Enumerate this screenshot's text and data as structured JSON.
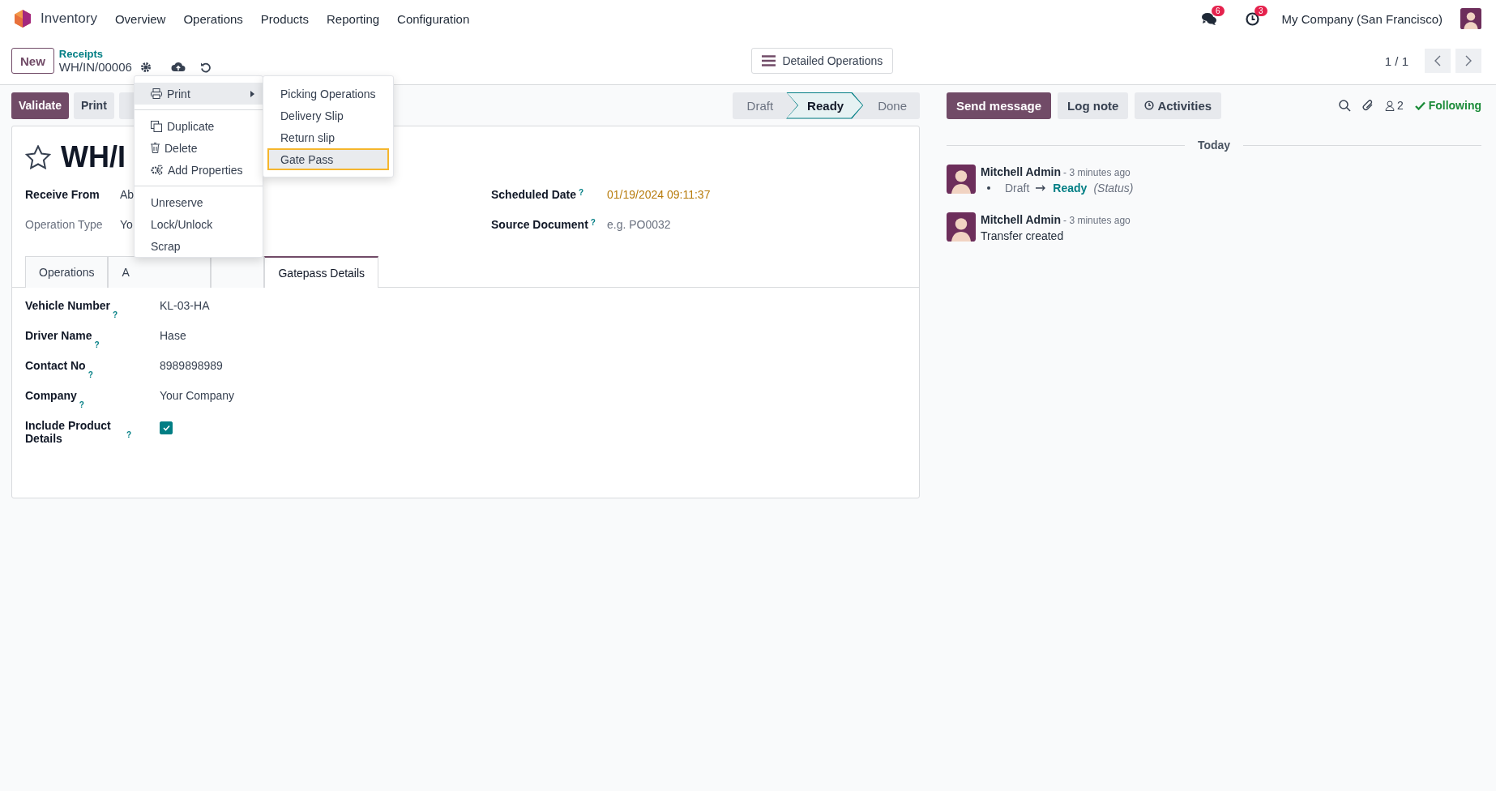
{
  "navbar": {
    "app_name": "Inventory",
    "menu": [
      "Overview",
      "Operations",
      "Products",
      "Reporting",
      "Configuration"
    ],
    "messages_badge": "6",
    "activities_badge": "3",
    "company": "My Company (San Francisco)"
  },
  "control_panel": {
    "new_button": "New",
    "breadcrumb": "Receipts",
    "record": "WH/IN/00006",
    "view_button": "Detailed Operations",
    "pager": "1 / 1"
  },
  "actions": {
    "buttons": [
      {
        "label": "Validate",
        "kind": "primary"
      },
      {
        "label": "Print",
        "kind": "secondary"
      },
      {
        "kind": "secondary"
      }
    ],
    "statusbar": [
      {
        "label": "Draft",
        "selected": false
      },
      {
        "label": "Ready",
        "selected": true
      },
      {
        "label": "Done",
        "selected": false
      }
    ]
  },
  "action_menu": {
    "groups": [
      [
        {
          "label": "Print",
          "kind": "submenu",
          "selected": true
        }
      ],
      [
        {
          "label": "Duplicate",
          "kind": "copy",
          "selected": false
        },
        {
          "label": "Delete",
          "kind": "trash",
          "selected": false
        },
        {
          "label": "Add Properties",
          "kind": "gears",
          "selected": false
        }
      ],
      [
        {
          "label": "Unreserve",
          "kind": "plain",
          "selected": false
        },
        {
          "label": "Lock/Unlock",
          "kind": "plain",
          "selected": false
        },
        {
          "label": "Scrap",
          "kind": "plain",
          "selected": false
        }
      ]
    ],
    "submenu": [
      {
        "label": "Picking Operations",
        "selected": false
      },
      {
        "label": "Delivery Slip",
        "selected": false
      },
      {
        "label": "Return slip",
        "selected": false
      },
      {
        "label": "Gate Pass",
        "selected": true
      }
    ]
  },
  "form": {
    "title": "WH/I",
    "starred": false,
    "left_fields": [
      {
        "label": "Receive From",
        "value": "Ab",
        "readonly": false
      },
      {
        "label": "Operation Type",
        "value": "Yo",
        "readonly": true
      }
    ],
    "right_fields": [
      {
        "label": "Scheduled Date",
        "help": "?",
        "kind": "date",
        "value": "01/19/2024 09:11:37"
      },
      {
        "label": "Source Document",
        "help": "?",
        "kind": "text",
        "placeholder": "e.g. PO0032"
      }
    ],
    "tabs": [
      {
        "label": "Operations",
        "selected": false
      },
      {
        "label": "A",
        "selected": false
      },
      {
        "selected": false
      },
      {
        "label": "Gatepass Details",
        "selected": true
      }
    ],
    "gatepass_fields": [
      {
        "label": "Vehicle Number",
        "help": "?",
        "kind": "text",
        "value": "KL-03-HA"
      },
      {
        "label": "Driver Name",
        "help": "?",
        "kind": "text",
        "value": "Hase"
      },
      {
        "label": "Contact No",
        "help": "?",
        "kind": "text",
        "value": "8989898989"
      },
      {
        "label": "Company",
        "help": "?",
        "kind": "text",
        "value": "Your Company"
      },
      {
        "label": "Include Product Details",
        "help": "?",
        "kind": "checkbox",
        "checked": true
      }
    ]
  },
  "chatter": {
    "buttons": [
      {
        "label": "Send message",
        "kind": "primary"
      },
      {
        "label": "Log note",
        "kind": "secondary"
      },
      {
        "label": "Activities",
        "kind": "activities"
      }
    ],
    "followers": "2",
    "following": "Following",
    "day": "Today",
    "messages": [
      {
        "author": "Mitchell Admin",
        "time": "- 3 minutes ago",
        "kind": "tracking",
        "from": "Draft",
        "to": "Ready",
        "field": "(Status)"
      },
      {
        "author": "Mitchell Admin",
        "time": "- 3 minutes ago",
        "kind": "text",
        "body": "Transfer created"
      }
    ]
  }
}
